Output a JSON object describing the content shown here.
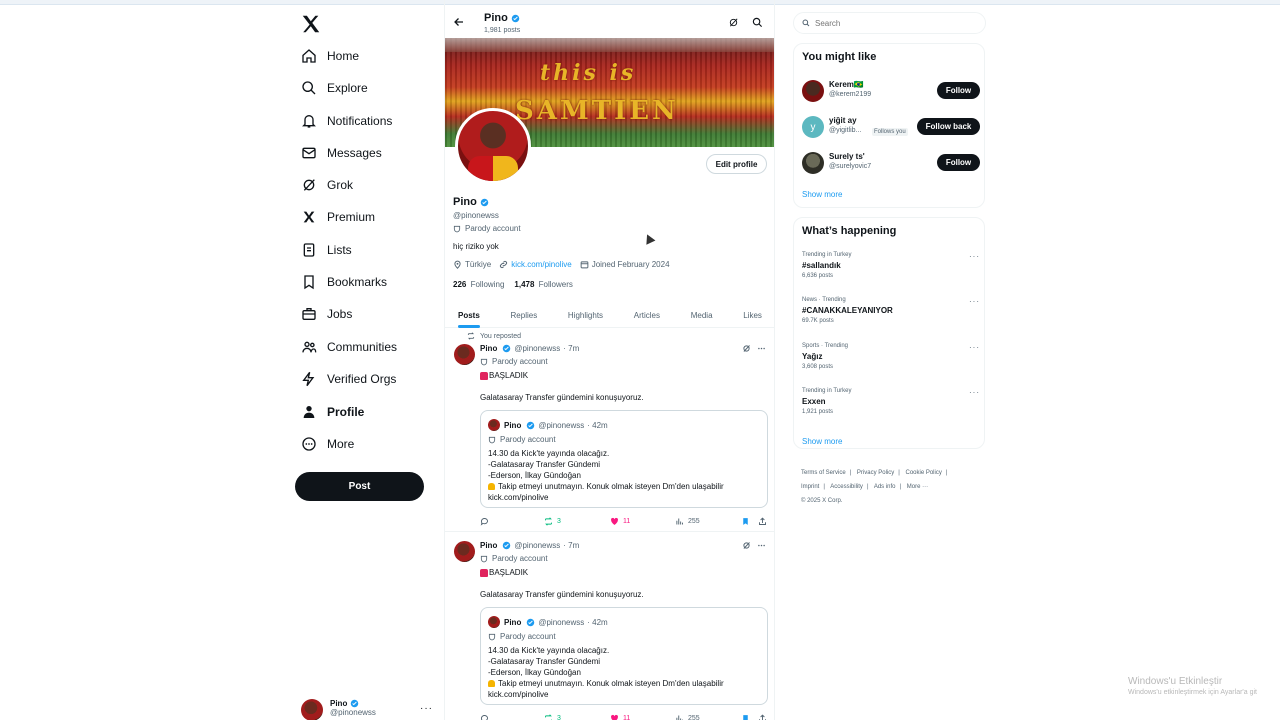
{
  "nav": {
    "items": [
      {
        "label": "Home",
        "icon": "home-icon"
      },
      {
        "label": "Explore",
        "icon": "search-icon"
      },
      {
        "label": "Notifications",
        "icon": "bell-icon"
      },
      {
        "label": "Messages",
        "icon": "mail-icon"
      },
      {
        "label": "Grok",
        "icon": "grok-icon"
      },
      {
        "label": "Premium",
        "icon": "x-logo-icon"
      },
      {
        "label": "Lists",
        "icon": "list-icon"
      },
      {
        "label": "Bookmarks",
        "icon": "bookmark-icon"
      },
      {
        "label": "Jobs",
        "icon": "briefcase-icon"
      },
      {
        "label": "Communities",
        "icon": "people-icon"
      },
      {
        "label": "Verified Orgs",
        "icon": "lightning-icon"
      },
      {
        "label": "Profile",
        "icon": "person-icon"
      },
      {
        "label": "More",
        "icon": "more-circle-icon"
      }
    ],
    "active": "Profile",
    "post_label": "Post"
  },
  "account": {
    "name": "Pino",
    "handle": "@pinonewss"
  },
  "header": {
    "name": "Pino",
    "post_count": "1,981 posts"
  },
  "banner": {
    "line1": "this is",
    "line2": "SAMTIEN"
  },
  "profile": {
    "edit_label": "Edit profile",
    "name": "Pino",
    "handle": "@pinonewss",
    "parody": "Parody account",
    "bio": "hiç riziko yok",
    "location": "Türkiye",
    "link": "kick.com/pinolive",
    "joined": "Joined February 2024",
    "following_count": "226",
    "following_label": "Following",
    "followers_count": "1,478",
    "followers_label": "Followers"
  },
  "tabs": [
    "Posts",
    "Replies",
    "Highlights",
    "Articles",
    "Media",
    "Likes"
  ],
  "tweets": [
    {
      "repost_label": "You reposted",
      "name": "Pino",
      "handle": "@pinonewss",
      "time": "· 7m",
      "parody": "Parody account",
      "line1": "BAŞLADIK",
      "line2": "Galatasaray Transfer gündemini konuşuyoruz.",
      "quote": {
        "name": "Pino",
        "handle": "@pinonewss",
        "time": "· 42m",
        "parody": "Parody account",
        "l1": "14.30 da Kick'te yayında olacağız.",
        "l2": "-Galatasaray Transfer Gündemi",
        "l3": "-Ederson, İlkay Gündoğan",
        "l4": "Takip etmeyi unutmayın. Konuk olmak isteyen Dm'den ulaşabilir",
        "l5": "kick.com/pinolive"
      },
      "reposts": "3",
      "likes": "11",
      "views": "255"
    },
    {
      "name": "Pino",
      "handle": "@pinonewss",
      "time": "· 7m",
      "parody": "Parody account",
      "line1": "BAŞLADIK",
      "line2": "Galatasaray Transfer gündemini konuşuyoruz.",
      "quote": {
        "name": "Pino",
        "handle": "@pinonewss",
        "time": "· 42m",
        "parody": "Parody account",
        "l1": "14.30 da Kick'te yayında olacağız.",
        "l2": "-Galatasaray Transfer Gündemi",
        "l3": "-Ederson, İlkay Gündoğan",
        "l4": "Takip etmeyi unutmayın. Konuk olmak isteyen Dm'den ulaşabilir",
        "l5": "kick.com/pinolive"
      },
      "reposts": "3",
      "likes": "11",
      "views": "255"
    }
  ],
  "search": {
    "placeholder": "Search"
  },
  "might_like": {
    "title": "You might like",
    "users": [
      {
        "name": "Kerem🇧🇷",
        "handle": "@kerem2199",
        "button": "Follow"
      },
      {
        "name": "yiğit ay",
        "handle": "@yigitlib...",
        "follows_you": "Follows you",
        "button": "Follow back",
        "initial": "y"
      },
      {
        "name": "Surely ts'",
        "handle": "@surelyovic7",
        "button": "Follow"
      }
    ],
    "show_more": "Show more"
  },
  "happening": {
    "title": "What’s happening",
    "trends": [
      {
        "context": "Trending in Turkey",
        "name": "#sallandık",
        "count": "6,636 posts"
      },
      {
        "context": "News · Trending",
        "name": "#CANAKKALEYANIYOR",
        "count": "69.7K posts"
      },
      {
        "context": "Sports · Trending",
        "name": "Yağız",
        "count": "3,608 posts"
      },
      {
        "context": "Trending in Turkey",
        "name": "Exxen",
        "count": "1,921 posts"
      }
    ],
    "show_more": "Show more"
  },
  "footer": {
    "links": [
      "Terms of Service",
      "|",
      "Privacy Policy",
      "|",
      "Cookie Policy",
      "|",
      "Imprint",
      "|",
      "Accessibility",
      "|",
      "Ads info",
      "|",
      "More ···"
    ],
    "copyright": "© 2025 X Corp."
  },
  "watermark": {
    "line1": "Windows'u Etkinleştir",
    "line2": "Windows'u etkinleştirmek için Ayarlar'a git"
  },
  "colors": {
    "accent": "#1d9bf0",
    "text": "#0f1419",
    "muted": "#536471",
    "like": "#f91880",
    "repost": "#00ba7c"
  }
}
